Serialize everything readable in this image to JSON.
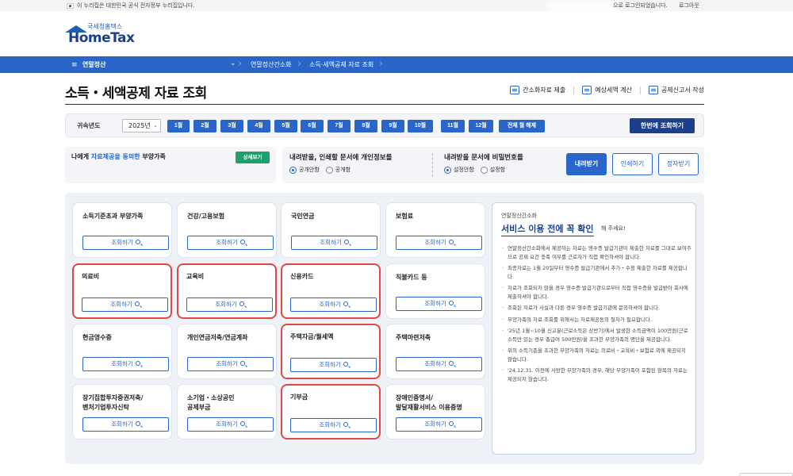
{
  "topbar": {
    "gov_notice": "이 누리집은 대한민국 공식 전자정부 누리집입니다.",
    "login_msg": "으로 로그인되었습니다.",
    "logout": "로그아웃"
  },
  "logo": {
    "sub": "국세청홈택스",
    "main": "HomeTax"
  },
  "nav": {
    "menu": "연말정산",
    "crumbs": [
      "연말정산간소화",
      "소득·세액공제 자료 조회"
    ]
  },
  "page": {
    "title": "소득・세액공제 자료 조회",
    "actions": [
      "간소화자료 제출",
      "예상세액 계산",
      "공제신고서 작성"
    ]
  },
  "year_bar": {
    "label": "귀속년도",
    "selected_year": "2025년",
    "months": [
      "1월",
      "2월",
      "3월",
      "4월",
      "5월",
      "6월",
      "7월",
      "8월",
      "9월",
      "10월",
      "11월",
      "12월"
    ],
    "all_clear": "전체 월 해제",
    "query_all": "한번에 조회하기"
  },
  "consent": {
    "prefix": "나에게",
    "highlight": "자료제공을 동의한",
    "suffix": "부양가족",
    "detail_button": "상세보기"
  },
  "options": {
    "personal_info_title": "내려받을, 인쇄할 문서에 개인정보를",
    "personal_info_options": [
      "공개안함",
      "공개함"
    ],
    "personal_info_selected": 0,
    "password_title": "내려받을 문서에 비밀번호를",
    "password_options": [
      "설정안함",
      "설정함"
    ],
    "password_selected": 0,
    "download": "내려받기",
    "print": "인쇄하기",
    "tax_forms": "정자받기"
  },
  "query_label": "조회하기",
  "cards": [
    {
      "name": "소득기준초과 부양가족",
      "highlighted": false
    },
    {
      "name": "건강/고용보험",
      "highlighted": false
    },
    {
      "name": "국민연금",
      "highlighted": false
    },
    {
      "name": "보험료",
      "highlighted": false
    },
    {
      "name": "의료비",
      "highlighted": true
    },
    {
      "name": "교육비",
      "highlighted": true
    },
    {
      "name": "신용카드",
      "highlighted": true
    },
    {
      "name": "직불카드 등",
      "highlighted": false
    },
    {
      "name": "현금영수증",
      "highlighted": false
    },
    {
      "name": "개인연금저축/연금계좌",
      "highlighted": false
    },
    {
      "name": "주택자금/월세액",
      "highlighted": true
    },
    {
      "name": "주택마련저축",
      "highlighted": false
    },
    {
      "name": "장기집합투자증권저축/\n벤처기업투자신탁",
      "highlighted": false
    },
    {
      "name": "소기업・소상공인\n공제부금",
      "highlighted": false
    },
    {
      "name": "기부금",
      "highlighted": true
    },
    {
      "name": "장애인증명서/\n발달재활서비스 이용증명",
      "highlighted": false
    }
  ],
  "notice": {
    "pre": "연말정산간소화",
    "head": "서비스 이용 전에 꼭 확인",
    "head_tail": "해 주세요!",
    "items": [
      "연말정산간소화에서 제공하는 자료는 영수증 발급기관이 제출한 자료를 그대로 보여주므로 공제 요건 충족 여부를 근로자가 직접 확인하셔야 합니다.",
      "최종자료는 1월 20일부터 영수증 발급기관에서 추가・수정 제출한 자료를 제공합니다.",
      "자료가 조회되지 않을 경우 영수증 발급기관으로부터 직접 영수증을 발급받아 회사에 제출하셔야 합니다.",
      "조회된 자료가 사실과 다른 경우 영수증 발급기관에 문의하셔야 합니다.",
      "부양가족의 자료 조회를 위해서는 자료제공동의 절차가 필요합니다.",
      "'25년 1월~10월 신고분(근로소득은 상반기)에서 발생한 소득금액이 100만원(근로소득만 있는 경우 총급여 500만원)을 초과한 부양가족의 명단을 제공합니다.",
      "위의 소득기준을 초과한 부양가족의 자료는 의료비・교육비・보험료 외에 제공되지 않습니다.",
      "'24.12.31. 이전에 사망한 부양가족의 경우, 해당 부양가족이 포함된 항목의 자료는 제공되지 않습니다."
    ]
  },
  "colors": {
    "primary": "#2a66c9",
    "navy": "#1b3f8b",
    "highlight_border": "#e04848",
    "detail_green": "#1f9e6f"
  }
}
